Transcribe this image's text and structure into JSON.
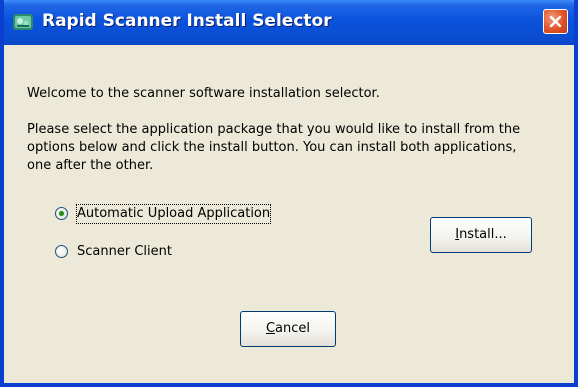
{
  "window": {
    "title": "Rapid Scanner Install Selector"
  },
  "content": {
    "welcome_text": "Welcome to the scanner software installation selector.",
    "instructions_line1": "Please select the application package that you would like to install from the",
    "instructions_line2": "options below and click the install button. You can install both applications,",
    "instructions_line3": "one after the other."
  },
  "options": [
    {
      "label": "Automatic Upload Application",
      "selected": true
    },
    {
      "label": "Scanner Client",
      "selected": false
    }
  ],
  "buttons": {
    "install_label_access": "I",
    "install_label_rest": "nstall...",
    "cancel_label_access": "C",
    "cancel_label_rest": "ancel"
  },
  "colors": {
    "titlebar": "#0b52dc",
    "window_bg": "#ece9d8",
    "close_button": "#e0532b"
  },
  "icons": {
    "app": "scanner-app-icon",
    "close": "close-icon"
  }
}
